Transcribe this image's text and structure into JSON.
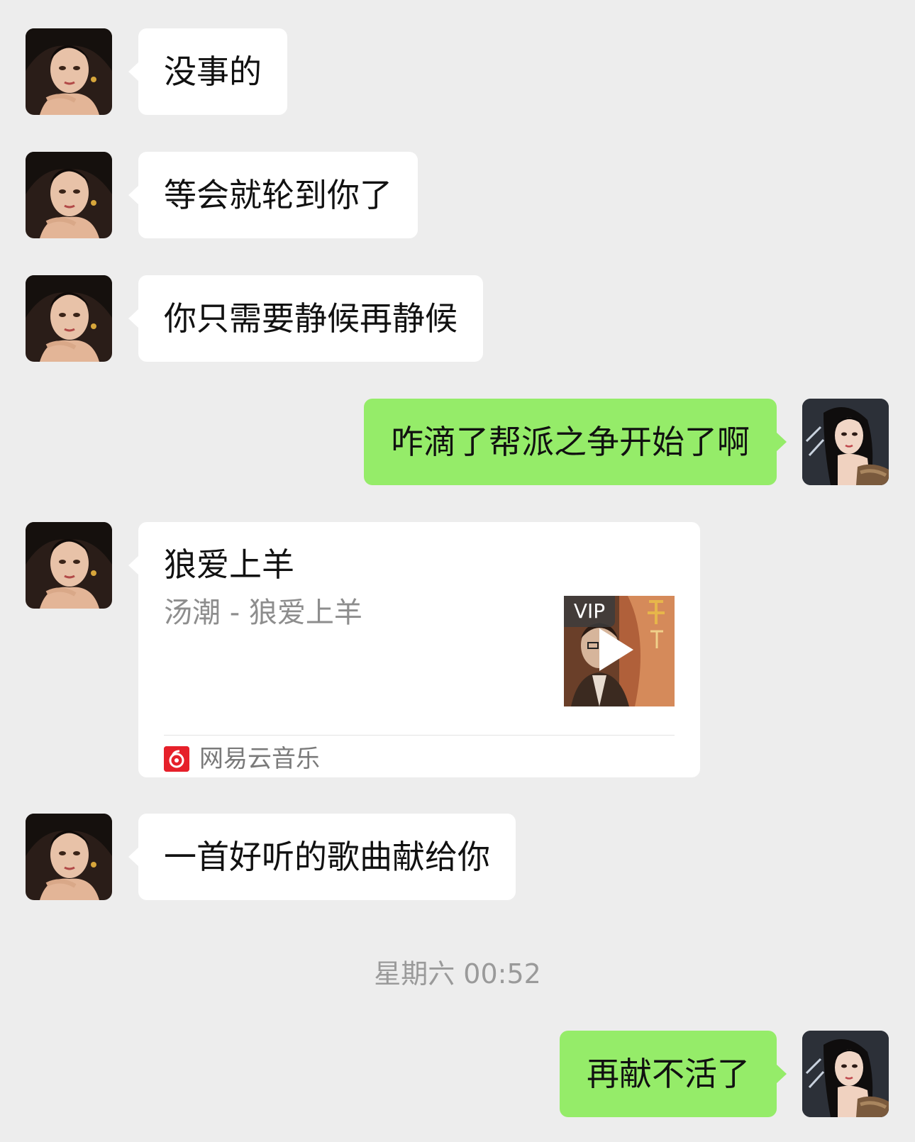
{
  "messages": [
    {
      "from": "other",
      "text": "没事的"
    },
    {
      "from": "other",
      "text": "等会就轮到你了"
    },
    {
      "from": "other",
      "text": "你只需要静候再静候"
    },
    {
      "from": "me",
      "text": "咋滴了帮派之争开始了啊"
    },
    {
      "from": "other",
      "text": "一首好听的歌曲献给你"
    },
    {
      "from": "me",
      "text": "再献不活了"
    }
  ],
  "music_card": {
    "title": "狼爱上羊",
    "subtitle": "汤潮 - 狼爱上羊",
    "badge": "VIP",
    "source": "网易云音乐",
    "source_icon": "netease-music-icon"
  },
  "timestamp": "星期六 00:52",
  "colors": {
    "background": "#ededed",
    "incoming_bubble": "#ffffff",
    "outgoing_bubble": "#95ec69",
    "netease_red": "#e6202a"
  }
}
